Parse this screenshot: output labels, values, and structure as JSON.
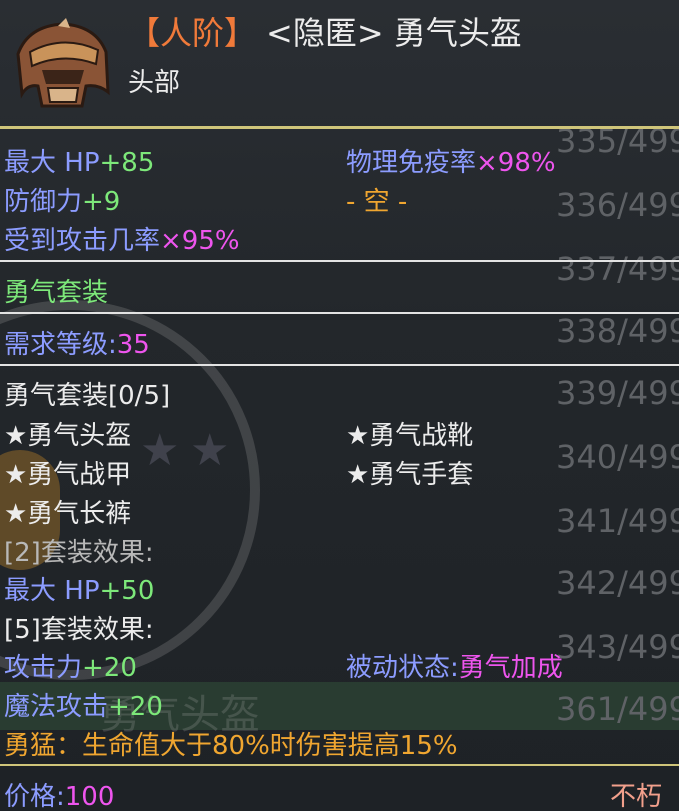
{
  "header": {
    "rank": "【人阶】",
    "item_name": "<隐匿> 勇气头盔",
    "slot": "头部",
    "icon": "helmet-icon"
  },
  "stats": {
    "max_hp_label": "最大 HP",
    "max_hp_value": "+85",
    "defense_label": "防御力",
    "defense_value": "+9",
    "hit_rate_label": "受到攻击几率",
    "hit_rate_value": "×95%",
    "phys_immune_label": "物理免疫率",
    "phys_immune_value": "×98%",
    "empty_slot": "- 空 -"
  },
  "set_name": "勇气套装",
  "requirement": {
    "label": "需求等级:",
    "value": "35"
  },
  "set": {
    "header": "勇气套装[0/5]",
    "pieces_left": [
      "★勇气头盔",
      "★勇气战甲",
      "★勇气长裤"
    ],
    "pieces_right": [
      "★勇气战靴",
      "★勇气手套"
    ],
    "bonus2_label": "[2]套装效果:",
    "bonus2_stat_label": "最大 HP",
    "bonus2_stat_value": "+50",
    "bonus5_label": "[5]套装效果:",
    "bonus5_attack_label": "攻击力",
    "bonus5_attack_value": "+20",
    "bonus5_magic_label": "魔法攻击",
    "bonus5_magic_value": "+20",
    "passive_label": "被动状态:",
    "passive_value": "勇气加成"
  },
  "skill_text": "勇猛：生命值大于80%时伤害提高15%",
  "footer": {
    "price_label": "价格:",
    "price_value": "100",
    "durability": "不朽"
  },
  "background": {
    "counters": [
      "335/499",
      "336/499",
      "337/499",
      "338/499",
      "339/499",
      "340/499",
      "341/499",
      "342/499",
      "343/499",
      "361/499"
    ],
    "ghost_title": "勇气头盔"
  }
}
